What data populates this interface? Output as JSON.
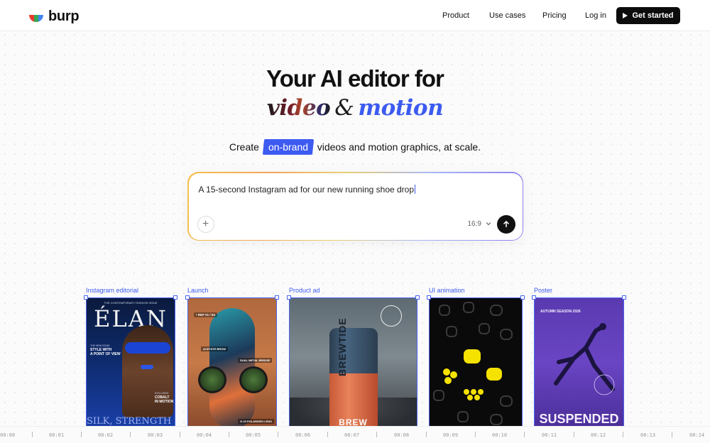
{
  "nav": {
    "brand": "burp",
    "links": [
      "Product",
      "Use cases",
      "Pricing",
      "Log in"
    ],
    "cta": "Get started"
  },
  "hero": {
    "title_line1": "Your AI editor for",
    "word_video": "video",
    "word_amp": "&",
    "word_motion": "motion",
    "tagline_prefix": "Create",
    "tagline_highlight": "on-brand",
    "tagline_suffix": "videos and motion graphics, at scale."
  },
  "prompt": {
    "value": "A 15-second Instagram ad for our new running shoe drop",
    "ratio": "16:9"
  },
  "cards": [
    {
      "label": "Instagram editorial",
      "title": "ÉLAN",
      "kicker": "THE CONTEMPORARY FASHION ISSUE",
      "lines": [
        "THE NEW ISSUE",
        "STYLE WITH",
        "A POINT OF VIEW",
        "EXCLUSIVE",
        "COBALT",
        "IN MOTION"
      ],
      "footer": "SILK, STRENGTH & STYLE"
    },
    {
      "label": "Launch",
      "tag1": "• REF 01 / 04",
      "tag2": "ACETATE BROW",
      "tag3": "DUAL METAL BRIDGE",
      "tag4": "G-15 POLARIZED LENS"
    },
    {
      "label": "Product ad",
      "brand": "BREWTIDE",
      "footer": "BREW"
    },
    {
      "label": "UI animation"
    },
    {
      "label": "Poster",
      "header": "AUTUMN SEASON 2026",
      "footer": "SUSPENDED"
    }
  ],
  "timeline": [
    "00:00",
    "00:01",
    "00:02",
    "00:03",
    "00:04",
    "00:05",
    "00:06",
    "00:07",
    "00:08",
    "00:09",
    "00:10",
    "00:11",
    "00:12",
    "00:13",
    "00:14"
  ],
  "colors": {
    "accent": "#3d5af1",
    "dark": "#0c0c0c"
  }
}
